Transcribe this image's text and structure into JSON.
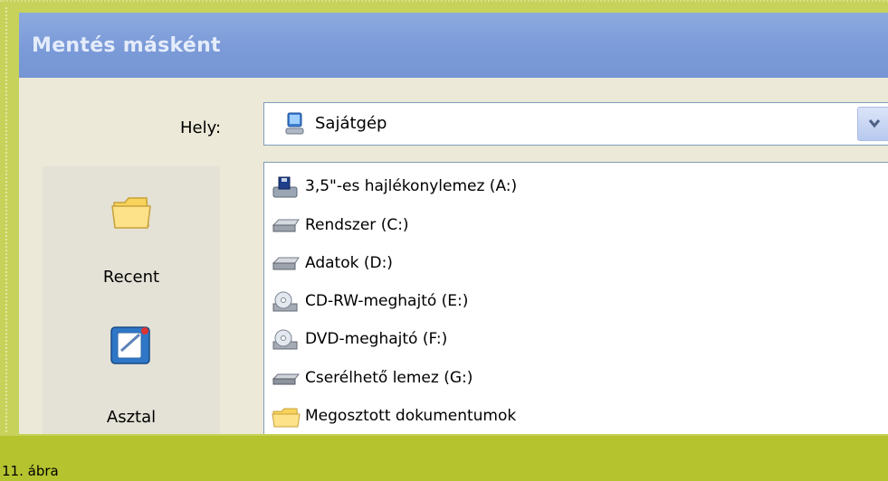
{
  "dialog": {
    "title": "Mentés másként",
    "hely_label": "Hely:",
    "hely_value": "Sajátgép",
    "hely_icon": "computer-icon",
    "dropdown_icon": "chevron-down-icon"
  },
  "places": [
    {
      "label": "Recent",
      "icon": "folder-icon"
    },
    {
      "label": "Asztal",
      "icon": "desktop-icon"
    }
  ],
  "files": [
    {
      "label": "3,5\"-es hajlékonylemez (A:)",
      "icon": "floppy-drive-icon"
    },
    {
      "label": "Rendszer  (C:)",
      "icon": "hard-drive-icon"
    },
    {
      "label": "Adatok (D:)",
      "icon": "hard-drive-icon"
    },
    {
      "label": "CD-RW-meghajtó (E:)",
      "icon": "cd-drive-icon"
    },
    {
      "label": "DVD-meghajtó (F:)",
      "icon": "dvd-drive-icon"
    },
    {
      "label": "Cserélhető lemez (G:)",
      "icon": "removable-drive-icon"
    },
    {
      "label": "Megosztott dokumentumok",
      "icon": "shared-folder-icon"
    }
  ],
  "caption": "11. ábra",
  "colors": {
    "titlebar": "#7b9ad8",
    "frame": "#c7d25a",
    "dialog_bg": "#ece9d8"
  }
}
